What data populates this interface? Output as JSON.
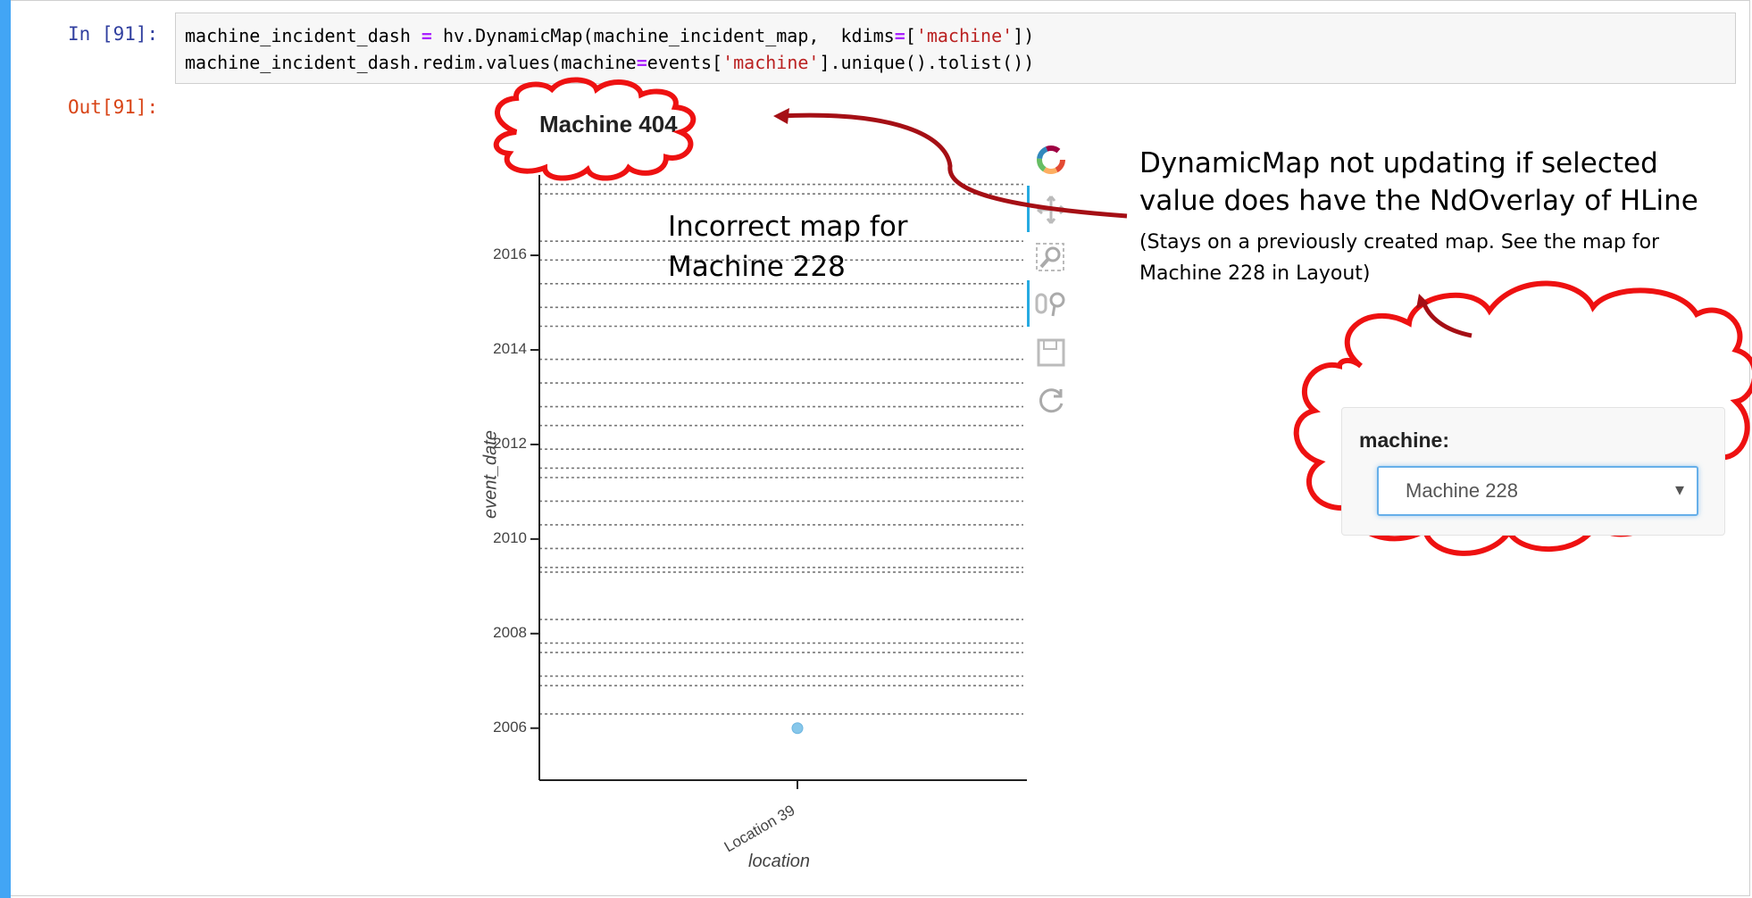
{
  "cell": {
    "in_prompt": "In [91]:",
    "out_prompt": "Out[91]:",
    "code": {
      "line1": {
        "a": "machine_incident_dash ",
        "op1": "=",
        "b": " hv.DynamicMap(machine_incident_map,  kdims",
        "op2": "=",
        "c": "[",
        "s1": "'machine'",
        "d": "])"
      },
      "line2": {
        "a": "machine_incident_dash.redim.values(machine",
        "op1": "=",
        "b": "events[",
        "s1": "'machine'",
        "c": "].unique().tolist())"
      }
    }
  },
  "plot": {
    "title": "Machine 404",
    "y_axis_label": "event_date",
    "x_axis_label": "location",
    "y_ticks": [
      "2016",
      "2014",
      "2012",
      "2010",
      "2008",
      "2006"
    ],
    "x_ticks": [
      "Location 39"
    ],
    "toolbar": [
      "bokeh-logo-icon",
      "pan-icon",
      "box-zoom-icon",
      "wheel-zoom-icon",
      "save-icon",
      "reset-icon"
    ]
  },
  "chart_data": {
    "type": "scatter",
    "title": "Machine 404",
    "xlabel": "location",
    "ylabel": "event_date",
    "categories": [
      "Location 39"
    ],
    "points": [
      {
        "x": "Location 39",
        "y": 2006.0
      }
    ],
    "hlines": [
      2017.5,
      2017.3,
      2016.3,
      2015.9,
      2015.4,
      2014.9,
      2014.5,
      2013.8,
      2013.3,
      2012.8,
      2012.4,
      2011.9,
      2011.5,
      2011.3,
      2010.8,
      2010.3,
      2009.8,
      2009.4,
      2009.3,
      2008.3,
      2007.8,
      2007.6,
      2007.1,
      2006.9,
      2006.3
    ],
    "ylim": [
      2004.9,
      2017.7
    ],
    "point_color": "#87c7ea",
    "hline_color": "#777777"
  },
  "annotations": {
    "main": "DynamicMap not updating if selected value does have the NdOverlay of HLine",
    "sub": "(Stays on a previously created map. See the map for Machine 228 in Layout)",
    "incorrect": "Incorrect map for Machine 228"
  },
  "widget": {
    "label": "machine:",
    "selected": "Machine 228",
    "caret": "▾"
  },
  "colors": {
    "cloud": "#ee1111",
    "arrow": "#a50f15",
    "cell_bar": "#42a5f5"
  }
}
